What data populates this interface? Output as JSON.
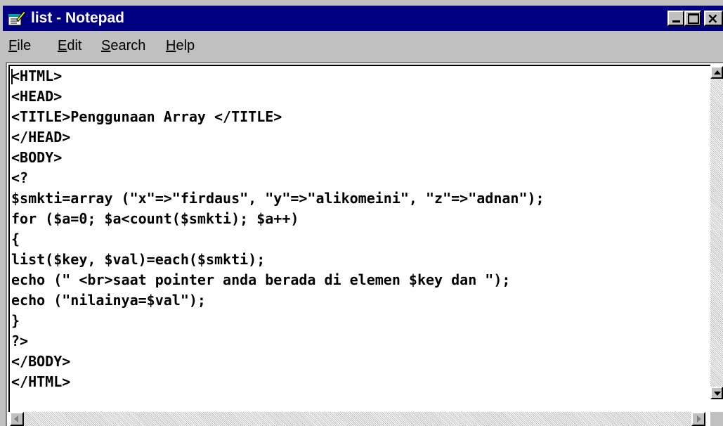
{
  "window": {
    "title": "list - Notepad",
    "title_bar_color": "#000080",
    "icon": "notepad-icon"
  },
  "controls": {
    "minimize_icon": "minimize-icon",
    "maximize_icon": "maximize-icon",
    "close_icon": "close-icon",
    "close_glyph": "×"
  },
  "menu": {
    "items": [
      {
        "accel": "F",
        "rest": "ile"
      },
      {
        "accel": "E",
        "rest": "dit"
      },
      {
        "accel": "S",
        "rest": "earch"
      },
      {
        "accel": "H",
        "rest": "elp"
      }
    ]
  },
  "editor": {
    "content": "<HTML>\n<HEAD>\n<TITLE>Penggunaan Array </TITLE>\n</HEAD>\n<BODY>\n<?\n$smkti=array (\"x\"=>\"firdaus\", \"y\"=>\"alikomeini\", \"z\"=>\"adnan\");\nfor ($a=0; $a<count($smkti); $a++)\n{\nlist($key, $val)=each($smkti);\necho (\" <br>saat pointer anda berada di elemen $key dan \");\necho (\"nilainya=$val\");\n}\n?>\n</BODY>\n</HTML>"
  }
}
